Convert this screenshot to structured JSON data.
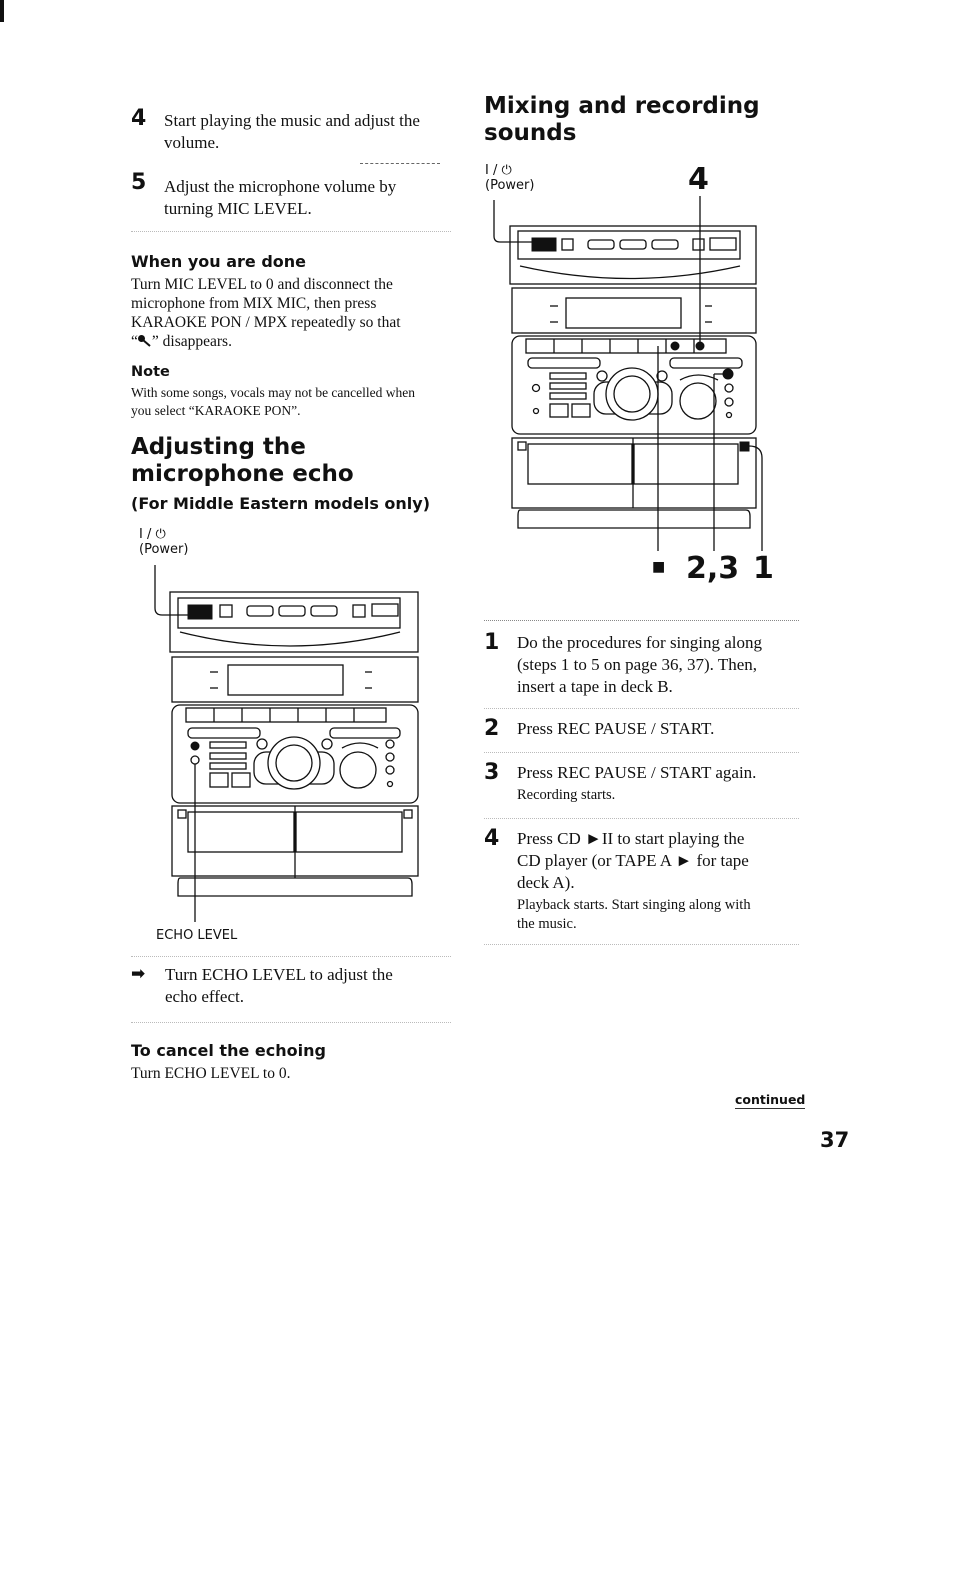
{
  "page_number": "37",
  "continued_label": "continued",
  "left_column": {
    "steps": [
      {
        "number": "4",
        "text": "Start playing the music and adjust the volume."
      },
      {
        "number": "5",
        "text": "Adjust the microphone volume by turning MIC LEVEL."
      }
    ],
    "when_done": {
      "heading": "When you are done",
      "body": "Turn MIC LEVEL to 0 and disconnect the microphone from MIX MIC, then press KARAOKE PON/MPX repeatedly so that “🎤” disappears.",
      "body_line1": "Turn MIC LEVEL to 0 and disconnect the",
      "body_line2": "microphone from MIX MIC, then press",
      "body_line3": "KARAOKE PON / MPX repeatedly so that",
      "body_line4_pre": "“",
      "body_line4_icon": "microphone-icon",
      "body_line4_post": "” disappears."
    },
    "note": {
      "heading": "Note",
      "line1": "With some songs, vocals may not be cancelled when",
      "line2": "you select “KARAOKE PON”."
    },
    "echo_section": {
      "title_line1": "Adjusting the",
      "title_line2": "microphone echo",
      "subtitle": "(For Middle Eastern models only)",
      "power_symbol": "I / ⏻",
      "power_label": "(Power)",
      "echo_level_label": "ECHO LEVEL",
      "instruction_arrow": "➡",
      "instruction_line1": "Turn ECHO LEVEL to adjust the",
      "instruction_line2": "echo effect."
    },
    "cancel_echo": {
      "heading": "To cancel the echoing",
      "body": "Turn ECHO LEVEL to 0."
    }
  },
  "right_column": {
    "title_line1": "Mixing and recording",
    "title_line2": "sounds",
    "power_symbol": "I / ⏻",
    "power_label": "(Power)",
    "callouts": {
      "top": "4",
      "stop": "■",
      "rec": "2,3",
      "deck": "1"
    },
    "steps": [
      {
        "number": "1",
        "lines": [
          "Do the procedures for singing along",
          "(steps 1 to 5 on page 36, 37). Then,",
          "insert a tape in deck B."
        ],
        "sub": []
      },
      {
        "number": "2",
        "lines": [
          "Press REC PAUSE / START."
        ],
        "sub": []
      },
      {
        "number": "3",
        "lines": [
          "Press REC PAUSE / START again."
        ],
        "sub": [
          "Recording starts."
        ]
      },
      {
        "number": "4",
        "lines": [
          "Press CD ►II to start playing the",
          "CD player (or TAPE A ► for tape",
          "deck A)."
        ],
        "sub": [
          "Playback starts.  Start singing along with",
          "the music."
        ]
      }
    ]
  }
}
